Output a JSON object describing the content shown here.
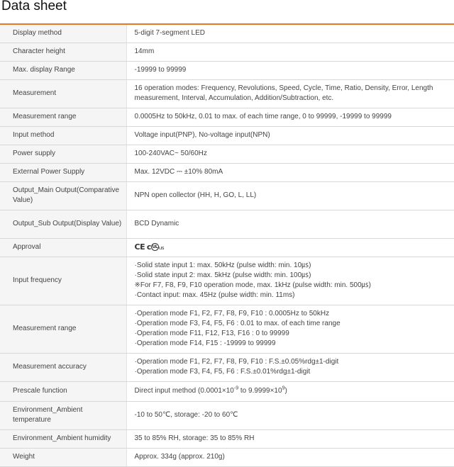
{
  "title": "Data sheet",
  "rows": [
    {
      "label": "Display method",
      "value": "5-digit 7-segment LED"
    },
    {
      "label": "Character height",
      "value": "14mm"
    },
    {
      "label": "Max. display Range",
      "value": "-19999 to 99999"
    },
    {
      "label": "Measurement",
      "value": "16 operation modes: Frequency, Revolutions, Speed, Cycle, Time, Ratio, Density, Error, Length measurement, Interval, Accumulation, Addition/Subtraction, etc."
    },
    {
      "label": "Measurement range",
      "value": "0.0005Hz to 50kHz, 0.01 to max. of each time range, 0 to 99999, -19999 to 99999"
    },
    {
      "label": "Input method",
      "value": "Voltage input(PNP), No-voltage input(NPN)"
    },
    {
      "label": "Power supply",
      "value": "100-240VAC~ 50/60Hz"
    },
    {
      "label": "External Power Supply",
      "value": "Max. 12VDC ⎓ ±10% 80mA"
    },
    {
      "label": "Output_Main Output(Comparative Value)",
      "value": "NPN open collector (HH, H, GO, L, LL)"
    },
    {
      "label": "Output_Sub Output(Display Value)",
      "value": "BCD Dynamic"
    },
    {
      "label": "Approval",
      "cert_ce": "CE",
      "cert_ul": "c",
      "cert_us": "us"
    },
    {
      "label": "Input frequency",
      "lines": [
        "·Solid state input 1: max. 50kHz (pulse width: min. 10㎲)",
        "·Solid state input 2: max. 5kHz (pulse width: min. 100㎲)",
        "※For F7, F8, F9, F10 operation mode, max. 1kHz (pulse width: min. 500㎲)",
        "·Contact input: max. 45Hz (pulse width: min. 11ms)"
      ]
    },
    {
      "label": "Measurement range",
      "lines": [
        "·Operation mode F1, F2, F7, F8, F9, F10 : 0.0005Hz to 50kHz",
        "·Operation mode F3, F4, F5, F6 : 0.01 to max. of each time range",
        "·Operation mode F11, F12, F13, F16 : 0 to 99999",
        "·Operation mode F14, F15 : -19999 to 99999"
      ]
    },
    {
      "label": "Measurement accuracy",
      "lines": [
        "·Operation mode F1, F2, F7, F8, F9, F10 : F.S.±0.05%rdg±1-digit",
        "·Operation mode F3, F4, F5, F6 : F.S.±0.01%rdg±1-digit"
      ]
    },
    {
      "label": "Prescale function",
      "value_pre": "Direct input method (0.0001×10",
      "exp1": "-9",
      "value_mid": " to 9.9999×10",
      "exp2": "9",
      "value_post": ")"
    },
    {
      "label": "Environment_Ambient temperature",
      "value": "-10 to 50℃, storage: -20 to 60℃"
    },
    {
      "label": "Environment_Ambient humidity",
      "value": "35 to 85% RH, storage: 35 to 85% RH"
    },
    {
      "label": "Weight",
      "value": "Approx. 334g (approx. 210g)"
    }
  ]
}
